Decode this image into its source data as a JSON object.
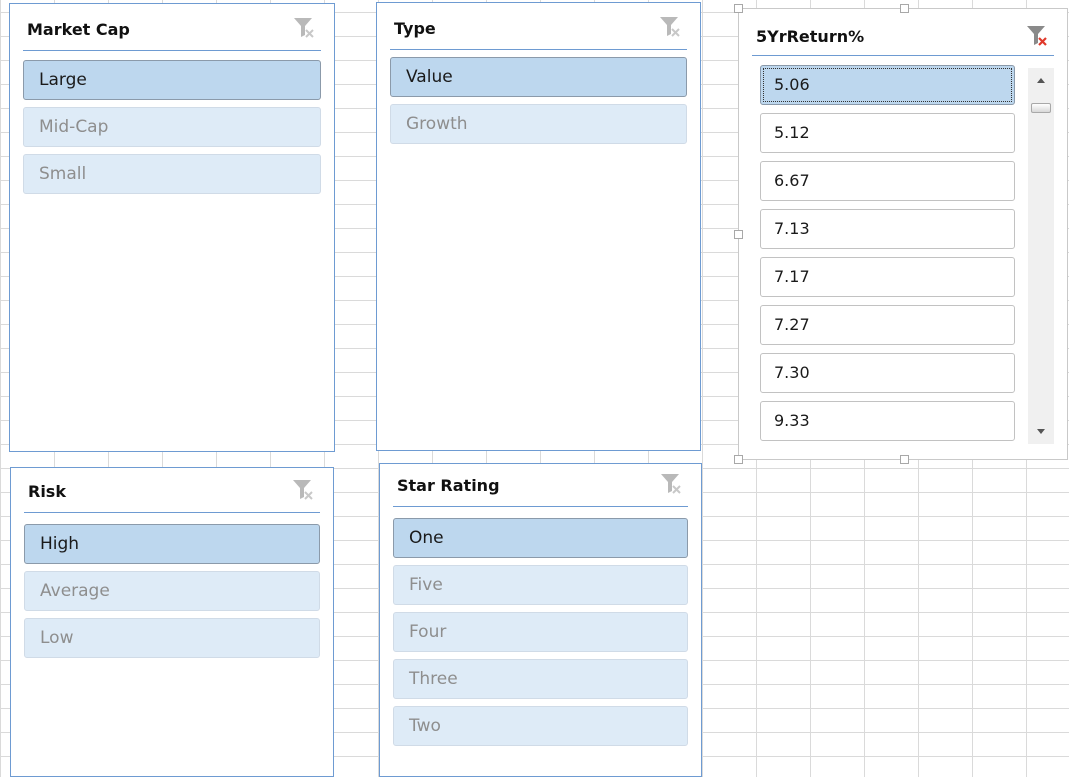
{
  "slicers": {
    "market_cap": {
      "title": "Market Cap",
      "items": [
        "Large",
        "Mid-Cap",
        "Small"
      ]
    },
    "type": {
      "title": "Type",
      "items": [
        "Value",
        "Growth"
      ]
    },
    "return5yr": {
      "title": "5YrReturn%",
      "items": [
        "5.06",
        "5.12",
        "6.67",
        "7.13",
        "7.17",
        "7.27",
        "7.30",
        "9.33"
      ]
    },
    "risk": {
      "title": "Risk",
      "items": [
        "High",
        "Average",
        "Low"
      ]
    },
    "star_rating": {
      "title": "Star Rating",
      "items": [
        "One",
        "Five",
        "Four",
        "Three",
        "Two"
      ]
    }
  },
  "colors": {
    "selected_item": "#bdd7ee",
    "unselected_item": "#deebf7",
    "slicer_border": "#6e9bd2",
    "clear_filter_active": "#e0392b"
  },
  "icons": {
    "clear_filter": "clear-filter-icon",
    "scroll_up": "scroll-up-arrow-icon",
    "scroll_down": "scroll-down-arrow-icon"
  }
}
